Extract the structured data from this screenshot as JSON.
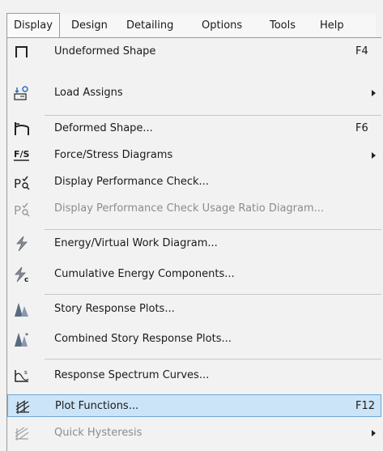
{
  "menubar": {
    "items": [
      {
        "label": "Display"
      },
      {
        "label": "Design"
      },
      {
        "label": "Detailing"
      },
      {
        "label": "Options"
      },
      {
        "label": "Tools"
      },
      {
        "label": "Help"
      }
    ]
  },
  "menu": {
    "items": [
      {
        "label": "Undeformed Shape",
        "shortcut": "F4",
        "icon": "undeformed-shape-icon"
      },
      {
        "label": "Load Assigns",
        "shortcut": "",
        "icon": "load-assigns-icon",
        "submenu": true
      },
      {
        "label": "Deformed Shape...",
        "shortcut": "F6",
        "icon": "deformed-shape-icon"
      },
      {
        "label": "Force/Stress Diagrams",
        "shortcut": "",
        "icon": "force-stress-icon",
        "submenu": true
      },
      {
        "label": "Display Performance Check...",
        "shortcut": "",
        "icon": "performance-check-icon"
      },
      {
        "label": "Display Performance Check Usage Ratio Diagram...",
        "shortcut": "",
        "icon": "usage-ratio-icon",
        "disabled": true
      },
      {
        "label": "Energy/Virtual Work Diagram...",
        "shortcut": "",
        "icon": "energy-icon"
      },
      {
        "label": "Cumulative Energy Components...",
        "shortcut": "",
        "icon": "cumulative-energy-icon"
      },
      {
        "label": "Story Response Plots...",
        "shortcut": "",
        "icon": "story-response-icon"
      },
      {
        "label": "Combined Story Response Plots...",
        "shortcut": "",
        "icon": "combined-story-icon"
      },
      {
        "label": "Response Spectrum Curves...",
        "shortcut": "",
        "icon": "response-spectrum-icon"
      },
      {
        "label": "Plot Functions...",
        "shortcut": "F12",
        "icon": "plot-functions-icon",
        "highlighted": true
      },
      {
        "label": "Quick Hysteresis",
        "shortcut": "",
        "icon": "quick-hysteresis-icon",
        "submenu": true,
        "disabled": true
      }
    ]
  },
  "colors": {
    "highlight_bg": "#cce4f7",
    "highlight_border": "#6aa6d6",
    "disabled_text": "#8c8c8c"
  }
}
